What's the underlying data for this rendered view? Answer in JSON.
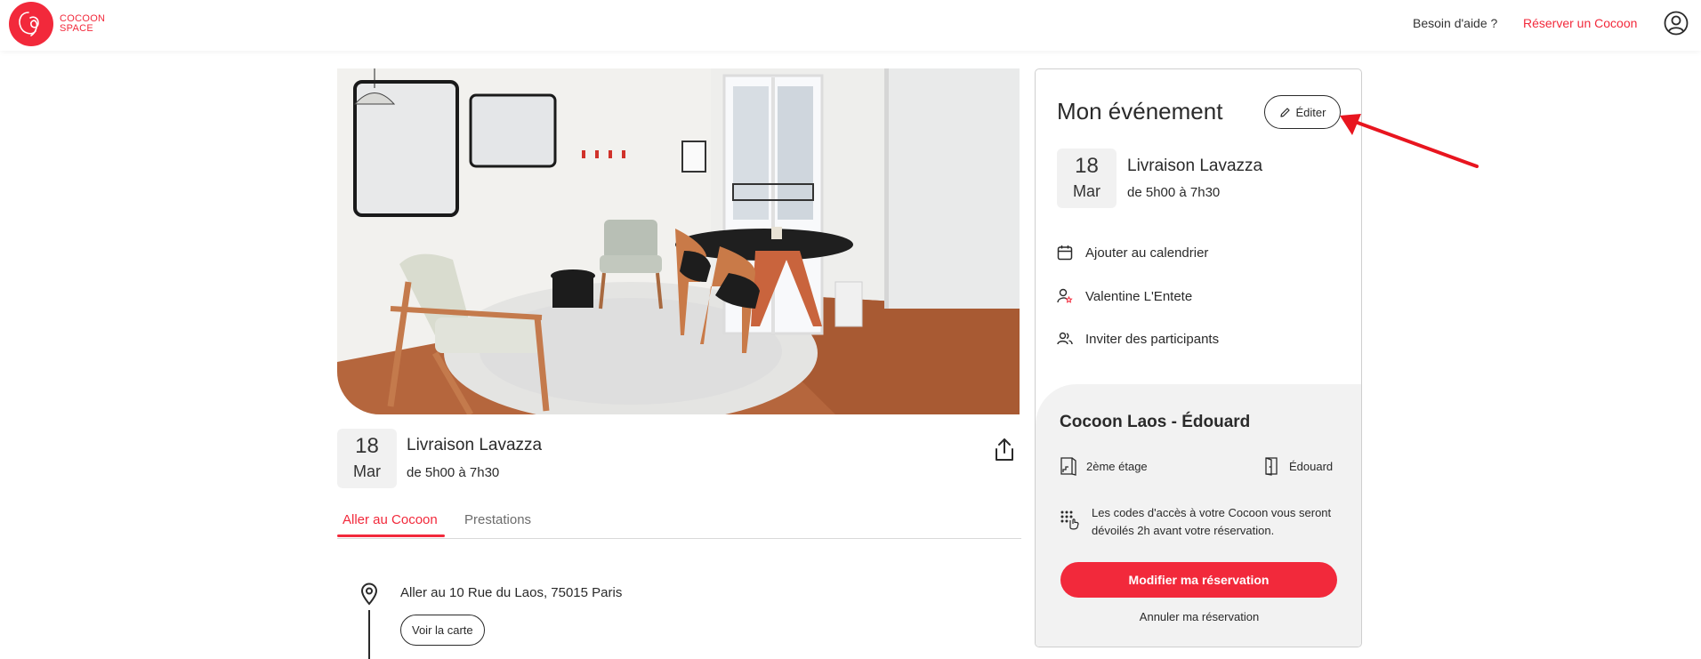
{
  "header": {
    "logo_line1": "COCOON",
    "logo_line2": "SPACE",
    "help_label": "Besoin d'aide ?",
    "book_label": "Réserver un Cocoon"
  },
  "event": {
    "day": "18",
    "month": "Mar",
    "title": "Livraison Lavazza",
    "time": "de 5h00 à 7h30"
  },
  "tabs": [
    {
      "label": "Aller au Cocoon",
      "active": true
    },
    {
      "label": "Prestations",
      "active": false
    }
  ],
  "itinerary": {
    "address": "Aller au 10 Rue du Laos, 75015 Paris",
    "map_button": "Voir la carte"
  },
  "panel": {
    "title": "Mon événement",
    "edit_label": "Éditer",
    "actions": [
      {
        "label": "Ajouter au calendrier",
        "icon": "calendar-icon"
      },
      {
        "label": "Valentine L'Entete",
        "icon": "host-icon"
      },
      {
        "label": "Inviter des participants",
        "icon": "people-icon"
      }
    ],
    "venue": {
      "title": "Cocoon Laos - Édouard",
      "floor": "2ème étage",
      "room": "Édouard",
      "codes_text": "Les codes d'accès à votre Cocoon vous seront dévoilés 2h avant votre réservation.",
      "modify_button": "Modifier ma réservation",
      "cancel_link": "Annuler ma réservation"
    }
  },
  "colors": {
    "accent": "#f2293b",
    "text": "#2a2a2a",
    "panel_grey": "#f2f2f2"
  }
}
